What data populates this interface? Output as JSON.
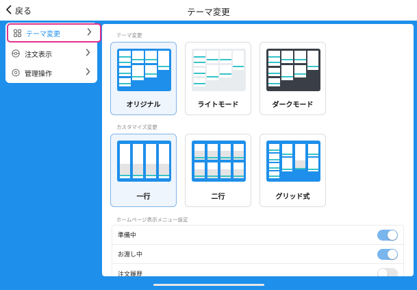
{
  "navbar": {
    "back_label": "戻る",
    "title": "テーマ変更"
  },
  "sidebar": {
    "items": [
      {
        "label": "テーマ変更",
        "icon": "grid-icon",
        "active": true
      },
      {
        "label": "注文表示",
        "icon": "eye-icon",
        "active": false
      },
      {
        "label": "管理操作",
        "icon": "gear-icon",
        "active": false
      }
    ]
  },
  "theme_section": {
    "label": "テーマ変更",
    "options": [
      {
        "name": "オリジナル",
        "selected": true
      },
      {
        "name": "ライトモード",
        "selected": false
      },
      {
        "name": "ダークモード",
        "selected": false
      }
    ]
  },
  "customize_section": {
    "label": "カスタマイズ変更",
    "options": [
      {
        "name": "一行",
        "selected": true
      },
      {
        "name": "二行",
        "selected": false
      },
      {
        "name": "グリッド式",
        "selected": false
      }
    ]
  },
  "menu_section": {
    "label": "ホームページ表示メニュー設定",
    "toggles": [
      {
        "label": "準備中",
        "on": true
      },
      {
        "label": "お渡し中",
        "on": true
      },
      {
        "label": "注文履歴",
        "on": false
      }
    ]
  },
  "colors": {
    "accent": "#1e8fea",
    "active_border": "#e2308c",
    "toggle_on": "#7ab6ee",
    "teal": "#35c3c8",
    "dark_theme": "#3a3f47"
  }
}
